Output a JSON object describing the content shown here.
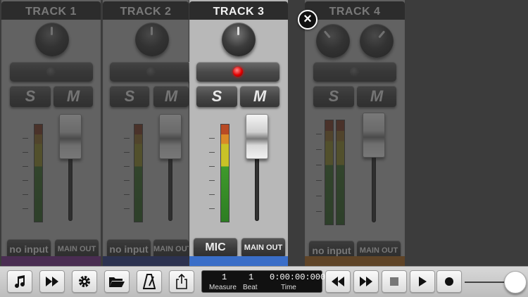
{
  "tracks": [
    {
      "title": "TRACK 1",
      "input_label": "no input",
      "output_label": "MAIN OUT",
      "solo_label": "S",
      "mute_label": "M",
      "active": false,
      "armed": false,
      "strip_color": "#7a2d8f",
      "meter_level": 0.0,
      "fader_level": 0.78
    },
    {
      "title": "TRACK 2",
      "input_label": "no input",
      "output_label": "MAIN OUT",
      "solo_label": "S",
      "mute_label": "M",
      "active": false,
      "armed": false,
      "strip_color": "#2a3a8a",
      "meter_level": 0.0,
      "fader_level": 0.78
    },
    {
      "title": "TRACK 3",
      "input_label": "MIC",
      "output_label": "MAIN OUT",
      "solo_label": "S",
      "mute_label": "M",
      "active": true,
      "armed": true,
      "strip_color": "#3a6ec8",
      "meter_level": 0.0,
      "fader_level": 0.78
    },
    {
      "title": "TRACK 4",
      "input_label": "no input",
      "output_label": "MAIN OUT",
      "solo_label": "S",
      "mute_label": "M",
      "active": false,
      "armed": false,
      "strip_color": "#b06a1e",
      "meter_level": 0.0,
      "fader_level": 0.78
    }
  ],
  "close_icon": "close-icon",
  "toolbar": {
    "buttons_left": [
      "music-note-icon",
      "fast-forward-icon",
      "gear-icon",
      "folder-icon",
      "metronome-icon",
      "share-icon"
    ],
    "buttons_right": [
      "rewind-icon",
      "fast-forward-icon",
      "stop-icon",
      "play-icon",
      "record-icon"
    ]
  },
  "transport": {
    "measure_value": "1",
    "beat_value": "1",
    "time_value": "0:00:00:000",
    "measure_label": "Measure",
    "beat_label": "Beat",
    "time_label": "Time"
  },
  "volume_level": 0.85
}
